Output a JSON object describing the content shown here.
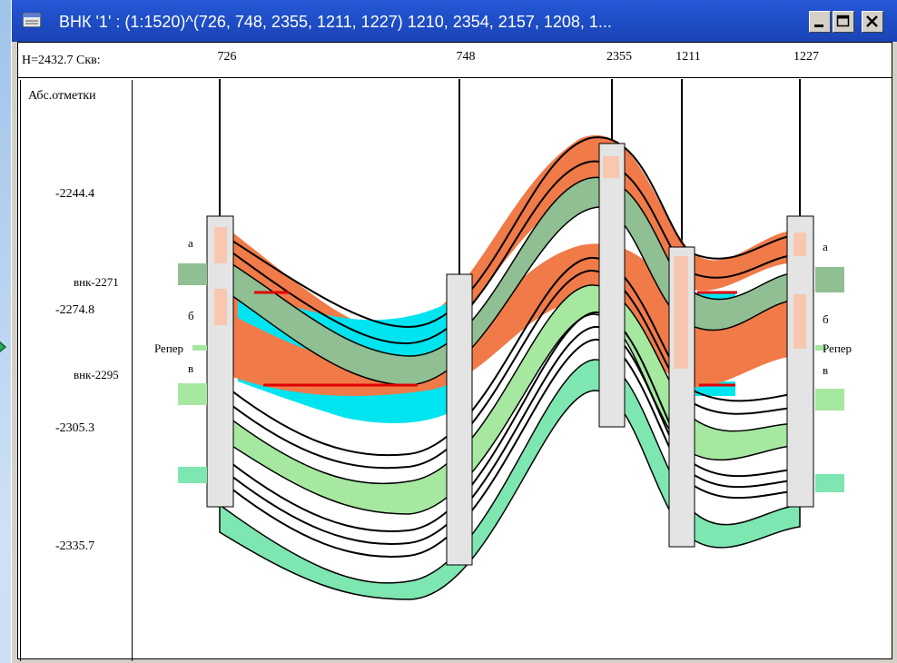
{
  "window": {
    "title": "ВНК '1' : (1:1520)^(726, 748, 2355, 1211, 1227) 1210, 2354, 2157, 1208, 1..."
  },
  "header": {
    "depth_label": "Н=2432.7 Скв:",
    "wells": [
      "726",
      "748",
      "2355",
      "1211",
      "1227"
    ]
  },
  "depth_panel": {
    "title": "Абс.отметки",
    "values": [
      "-2244.4",
      "-2274.8",
      "-2305.3",
      "-2335.7"
    ],
    "vnk": [
      "внк-2271",
      "внк-2295"
    ]
  },
  "zones": {
    "a": "а",
    "b": "б",
    "v": "в",
    "reper": "Репер"
  },
  "colors": {
    "oil": "#f07a48",
    "water": "#00e4f0",
    "green": "#8fbf92",
    "light_green": "#a6e8a0",
    "aqua_green": "#7ee6b0",
    "well_column": "#e4e4e4",
    "titlebar": "#1f4fc9"
  }
}
